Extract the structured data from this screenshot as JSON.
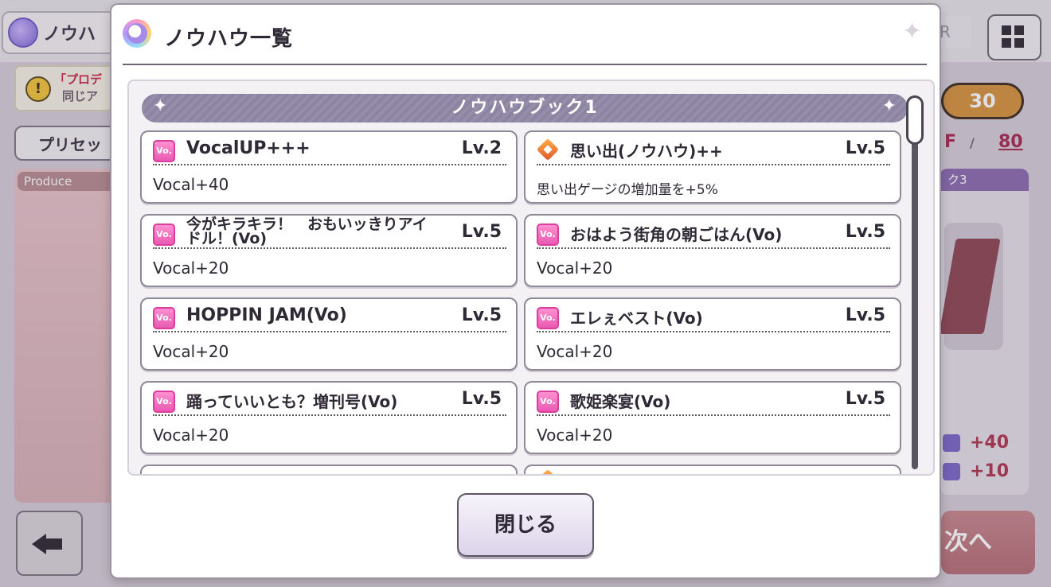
{
  "background": {
    "title_chip": "ノウハ",
    "warning_line1": "「プロデ",
    "warning_line2": "同じア",
    "preset_label": "プリセッ",
    "produce_label": "Produce",
    "rank_label": "R",
    "stamina": "30",
    "fans_unit": "F",
    "fans_sep": "/",
    "fans_value": "80",
    "right_panel_header": "ク3",
    "stat_da": "+40",
    "stat_mental": "+10",
    "next_label": "次へ"
  },
  "dialog": {
    "title": "ノウハウ一覧",
    "book_title": "ノウハウブック1",
    "close_label": "閉じる",
    "cards": [
      {
        "icon": "vocal-badge-icon",
        "badge": "Vo.",
        "name": "VocalUP+++",
        "level": "Lv.2",
        "desc": "Vocal+40"
      },
      {
        "icon": "memory-diamond-icon",
        "badge": "",
        "name": "思い出(ノウハウ)++",
        "level": "Lv.5",
        "desc": "思い出ゲージの増加量を+5%"
      },
      {
        "icon": "vocal-badge-icon",
        "badge": "Vo.",
        "name": "今がキラキラ！　おもいッきりアイドル！(Vo)",
        "level": "Lv.5",
        "desc": "Vocal+20"
      },
      {
        "icon": "vocal-badge-icon",
        "badge": "Vo.",
        "name": "おはよう街角の朝ごはん(Vo)",
        "level": "Lv.5",
        "desc": "Vocal+20"
      },
      {
        "icon": "vocal-badge-icon",
        "badge": "Vo.",
        "name": "HOPPIN JAM(Vo)",
        "level": "Lv.5",
        "desc": "Vocal+20"
      },
      {
        "icon": "vocal-badge-icon",
        "badge": "Vo.",
        "name": "エレぇベスト(Vo)",
        "level": "Lv.5",
        "desc": "Vocal+20"
      },
      {
        "icon": "vocal-badge-icon",
        "badge": "Vo.",
        "name": "踊っていいとも？増刊号(Vo)",
        "level": "Lv.5",
        "desc": "Vocal+20"
      },
      {
        "icon": "vocal-badge-icon",
        "badge": "Vo.",
        "name": "歌姫楽宴(Vo)",
        "level": "Lv.5",
        "desc": "Vocal+20"
      }
    ]
  },
  "colors": {
    "vocal_pink": "#e95bb2",
    "banner": "#8c84a0",
    "memory_orange": "#e0562a"
  }
}
